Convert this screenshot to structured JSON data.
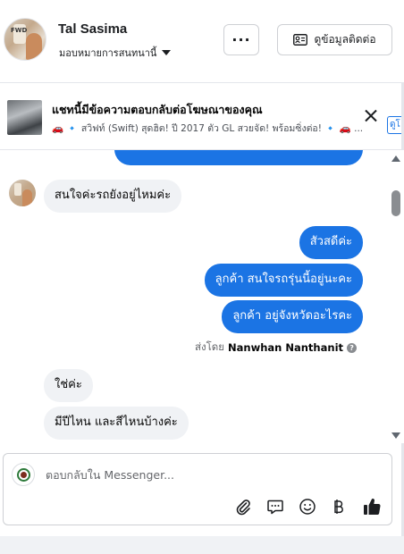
{
  "header": {
    "name": "Tal Sasima",
    "assignment_label": "มอบหมายการสนทนานี้",
    "more_label": "···",
    "contact_label": "ดูข้อมูลติดต่อ",
    "avatar_text": "FWD"
  },
  "ad_banner": {
    "title": "แชทนี้มีข้อความตอบกลับต่อโฆษณาของคุณ",
    "preview": "🚗 🔹 สวิฟท์ (Swift) สุดฮิต! ปี 2017 ตัว GL สวยจัด! พร้อมซิ่งต่อ! 🔹 🚗 ...",
    "view_label": "ดูโ"
  },
  "messages": [
    {
      "direction": "in",
      "text": "สนใจค่ะรถยังอยู่ไหมค่ะ"
    },
    {
      "direction": "out",
      "text": "สัวสดีค่ะ"
    },
    {
      "direction": "out",
      "text": "ลูกค้า สนใจรถรุ่นนี้อยู่นะคะ"
    },
    {
      "direction": "out",
      "text": "ลูกค้า  อยู่จังหวัดอะไรคะ"
    },
    {
      "direction": "in",
      "text": "ใช่ค่ะ"
    },
    {
      "direction": "in",
      "text": "มีปีไหน และสีไหนบ้างค่ะ"
    }
  ],
  "sent_by": {
    "prefix": "ส่งโดย",
    "agent": "Nanwhan Nanthanit",
    "help": "?"
  },
  "composer": {
    "placeholder": "ตอบกลับใน Messenger..."
  },
  "colors": {
    "accent": "#1b74e4",
    "incoming_bubble": "#f0f2f5"
  }
}
